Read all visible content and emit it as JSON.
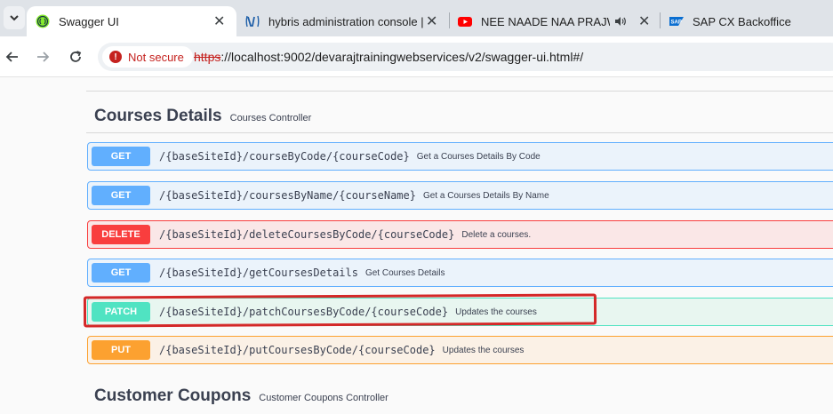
{
  "browser": {
    "tabs": [
      {
        "title": "Swagger UI",
        "icon": "swagger-favicon",
        "active": true
      },
      {
        "title": "hybris administration console | (",
        "icon": "hybris-favicon",
        "active": false
      },
      {
        "title": "NEE NAADE NAA PRAJWAL",
        "icon": "youtube-favicon",
        "active": false
      },
      {
        "title": "SAP CX Backoffice",
        "icon": "sap-favicon",
        "active": false
      }
    ],
    "security_label": "Not secure",
    "url_scheme": "https",
    "url_rest": "://localhost:9002/devarajtrainingwebservices/v2/swagger-ui.html#/"
  },
  "sections": [
    {
      "title": "Courses Details",
      "description": "Courses Controller",
      "operations": [
        {
          "method": "GET",
          "path": "/{baseSiteId}/courseByCode/{courseCode}",
          "summary": "Get a Courses Details By Code"
        },
        {
          "method": "GET",
          "path": "/{baseSiteId}/coursesByName/{courseName}",
          "summary": "Get a Courses Details By Name"
        },
        {
          "method": "DELETE",
          "path": "/{baseSiteId}/deleteCoursesByCode/{courseCode}",
          "summary": "Delete a courses."
        },
        {
          "method": "GET",
          "path": "/{baseSiteId}/getCoursesDetails",
          "summary": "Get Courses Details"
        },
        {
          "method": "PATCH",
          "path": "/{baseSiteId}/patchCoursesByCode/{courseCode}",
          "summary": "Updates the courses"
        },
        {
          "method": "PUT",
          "path": "/{baseSiteId}/putCoursesByCode/{courseCode}",
          "summary": "Updates the courses"
        }
      ]
    },
    {
      "title": "Customer Coupons",
      "description": "Customer Coupons Controller"
    }
  ],
  "colors": {
    "get": "#61affe",
    "delete": "#f93e3e",
    "patch": "#50e3c2",
    "put": "#fca130",
    "annotation": "#d42828"
  }
}
